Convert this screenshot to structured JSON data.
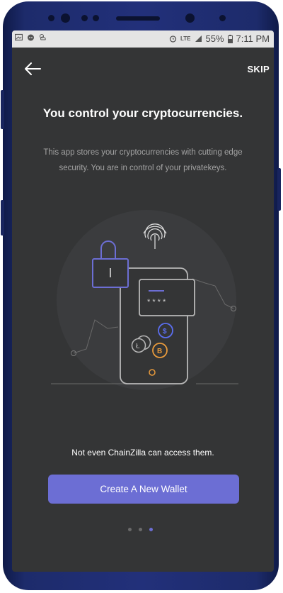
{
  "status_bar": {
    "battery": "55%",
    "time": "7:11 PM",
    "network": "LTE"
  },
  "header": {
    "skip_label": "SKIP"
  },
  "onboarding": {
    "title": "You control your cryptocurrencies.",
    "description": "This app stores your cryptocurrencies with cutting edge security. You are in control of your privatekeys.",
    "note": "Not even ChainZilla can access them.",
    "card_mask": "* * * *",
    "coins": {
      "dollar": "$",
      "bitcoin": "B",
      "litecoin": "Ł"
    }
  },
  "actions": {
    "create_wallet_label": "Create A New Wallet"
  },
  "pager": {
    "total": 3,
    "active_index": 2
  },
  "colors": {
    "accent": "#6c6ed4",
    "background": "#343536",
    "coin_blue": "#5b6ef0",
    "coin_orange": "#e89a3c"
  }
}
